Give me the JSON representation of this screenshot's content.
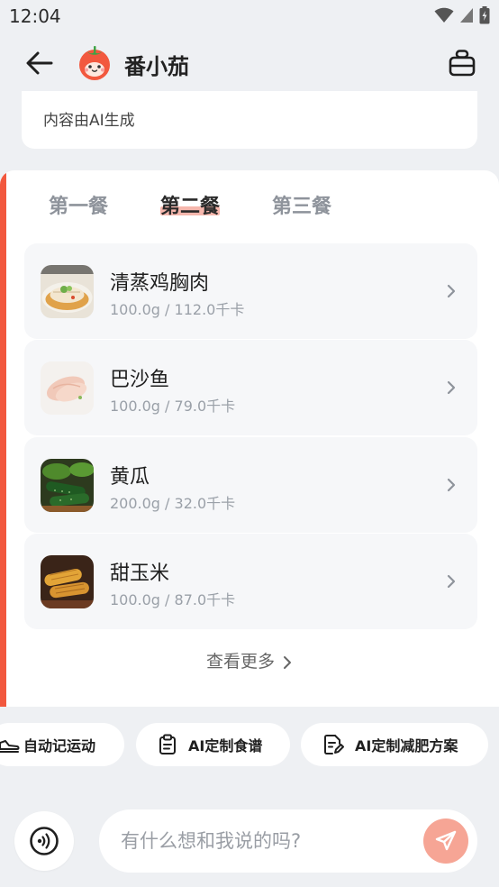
{
  "status_bar": {
    "time": "12:04",
    "icons": [
      "wifi-icon",
      "signal-icon",
      "battery-charging-icon"
    ]
  },
  "header": {
    "title": "番小茄",
    "back_icon": "back-arrow-icon",
    "avatar_icon": "tomato-mascot-icon",
    "action_icon": "shopping-basket-icon"
  },
  "notice": {
    "text": "内容由AI生成"
  },
  "meal_plan": {
    "accent_color": "#f2583e",
    "tabs": [
      {
        "label": "第一餐",
        "active": false
      },
      {
        "label": "第二餐",
        "active": true
      },
      {
        "label": "第三餐",
        "active": false
      }
    ],
    "items": [
      {
        "name": "清蒸鸡胸肉",
        "detail": "100.0g / 112.0千卡",
        "image": "steamed-chicken-breast-photo"
      },
      {
        "name": "巴沙鱼",
        "detail": "100.0g / 79.0千卡",
        "image": "basa-fish-photo"
      },
      {
        "name": "黄瓜",
        "detail": "200.0g / 32.0千卡",
        "image": "cucumber-photo"
      },
      {
        "name": "甜玉米",
        "detail": "100.0g / 87.0千卡",
        "image": "sweet-corn-photo"
      }
    ],
    "view_more_label": "查看更多"
  },
  "quick_actions": [
    {
      "label": "自动记运动",
      "icon": "sneaker-icon"
    },
    {
      "label": "AI定制食谱",
      "icon": "clipboard-icon"
    },
    {
      "label": "AI定制减肥方案",
      "icon": "document-edit-icon"
    }
  ],
  "chat": {
    "placeholder": "有什么想和我说的吗?",
    "voice_icon": "voice-icon",
    "send_icon": "send-icon",
    "send_color": "#f6a595"
  }
}
